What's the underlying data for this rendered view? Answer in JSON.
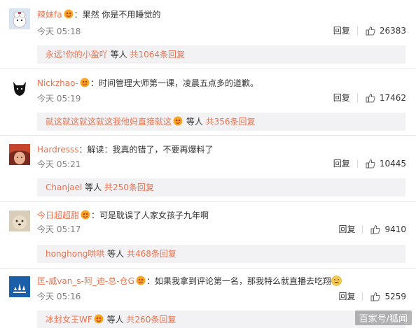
{
  "comments": [
    {
      "username": "辣妹fa",
      "text": "果然 你是不用睡觉的",
      "time": "今天 05:18",
      "reply_label": "回复",
      "likes": "26383",
      "replies": {
        "name": "永远!你的小盈吖",
        "middle": " 等人 ",
        "count": "共1064条回复"
      }
    },
    {
      "username": "Nickzhao-",
      "text": "时间管理大师第一课，凌晨五点多的道歉。",
      "time": "今天 05:19",
      "reply_label": "回复",
      "likes": "17462",
      "replies": {
        "name": "就这就这就这就这我他妈直接就这",
        "middle": " 等人 ",
        "count": "共356条回复"
      }
    },
    {
      "username": "Hardresss",
      "text": "解读：我真的错了，不要再爆料了",
      "time": "今天 05:21",
      "reply_label": "回复",
      "likes": "10445",
      "replies": {
        "name": "Chanjael",
        "middle": " 等人 ",
        "count": "共250条回复"
      }
    },
    {
      "username": "今日超超甜",
      "text": "可是耽误了人家女孩子九年啊",
      "time": "今天 05:17",
      "reply_label": "回复",
      "likes": "9410",
      "replies": {
        "name": "honghong哄哄",
        "middle": " 等人 ",
        "count": "共468条回复"
      }
    },
    {
      "username": "匡-威van_s-阿_迪-总-仓G",
      "text": "如果我拿到评论第一名，那我特么就直播去吃翔",
      "time": "今天 05:16",
      "reply_label": "回复",
      "likes": "5259",
      "replies": {
        "name": "冰封女王WF",
        "middle": " 等人 ",
        "count": "共260条回复"
      }
    }
  ],
  "separator": "：",
  "watermark": "百家号/狐闻",
  "colors": {
    "username": "#eb7350",
    "reply_bg": "#f2f2f5",
    "meta": "#808080"
  },
  "icons": {
    "badge": "vip-badge-icon",
    "like": "thumbs-up-icon",
    "emoji": "grin-emoji-icon"
  }
}
